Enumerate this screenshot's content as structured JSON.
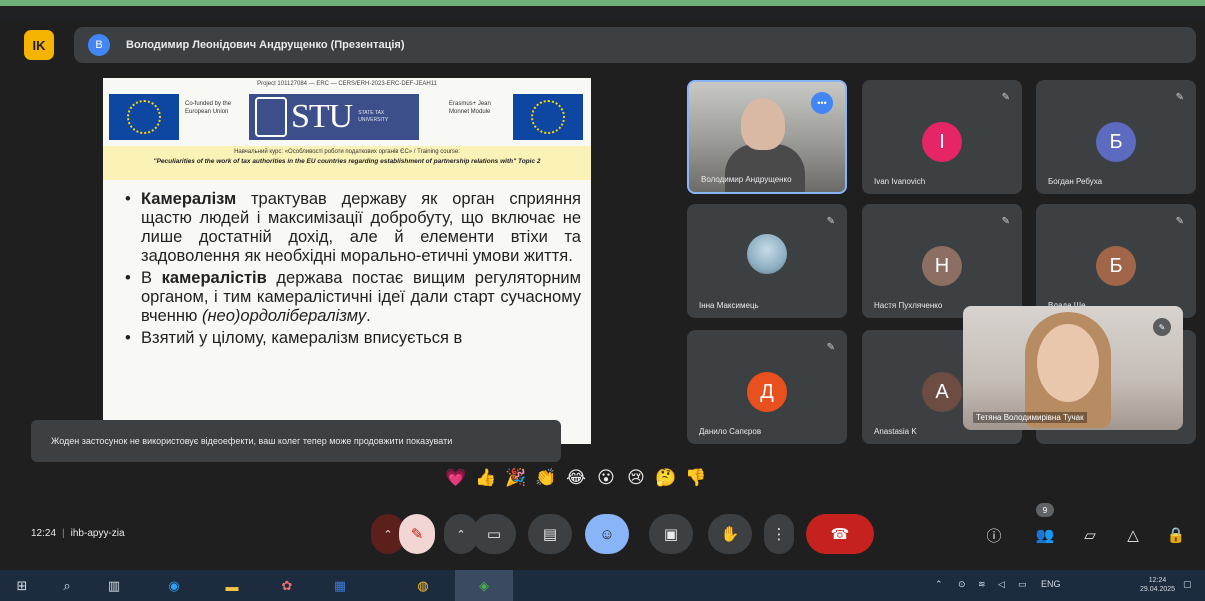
{
  "app": {
    "badge_label": "IK"
  },
  "presenter": {
    "avatar_letter": "В",
    "name": "Володимир Леонідович Андрущенко (Презентація)"
  },
  "slide": {
    "project_line": "Project 101127084 — ERC — CERS/ERH-2023-ERC-DEF-JEAH11",
    "eu_caption_left": "Co-funded by the European Union",
    "stu_letters": "STU",
    "stu_caption": "STATE TAX UNIVERSITY",
    "eu_caption_right": "Erasmus+ Jean Monnet Module",
    "course_line1": "Навчальний курс: «Особливості роботи податкових органів ЄС» / Training course:",
    "course_line2": "\"Peculiarities of the work of tax authorities in the EU countries regarding establishment of partnership relations with\" Topic 2",
    "bullet1_bold": "Камералізм",
    "bullet1_text": " трактував державу як орган сприяння щастю людей і максимізації добробуту, що включає не лише достатній дохід, але й елементи втіхи та задоволення як необхідні морально-етичні умови життя.",
    "bullet2_pre": "В ",
    "bullet2_bold": "камералістів",
    "bullet2_text": " держава постає вищим регуляторним органом, і тим камералістичні ідеї дали старт сучасному вченню ",
    "bullet2_italic": "(нео)ордолібералізму",
    "bullet2_end": ".",
    "bullet3_text": "Взятий у цілому, камералізм вписується в"
  },
  "notice": {
    "text": "Жоден застосунок не використовує відеоефекти, ваш колег тепер може продовжити показувати"
  },
  "tiles": [
    {
      "name": "Володимир Андрущенко",
      "avatar": "",
      "color": "",
      "type": "video"
    },
    {
      "name": "Ivan Ivanovich",
      "avatar": "І",
      "color": "#e52565",
      "type": "avatar"
    },
    {
      "name": "Богдан Ребуха",
      "avatar": "Б",
      "color": "#5c6bc0",
      "type": "avatar"
    },
    {
      "name": "Інна Максимець",
      "avatar": "",
      "color": "",
      "type": "photo"
    },
    {
      "name": "Настя Пухляченко",
      "avatar": "Н",
      "color": "#8d6e63",
      "type": "avatar"
    },
    {
      "name": "Влада Ше",
      "avatar": "Б",
      "color": "#a1664a",
      "type": "avatar"
    },
    {
      "name": "Данило Сапєров",
      "avatar": "Д",
      "color": "#e8501e",
      "type": "avatar"
    },
    {
      "name": "Anastasia K",
      "avatar": "А",
      "color": "#6d4c41",
      "type": "avatar"
    }
  ],
  "selfview": {
    "name": "Тетяна Володимирівна Тучак"
  },
  "reactions": [
    "💗",
    "👍",
    "🎉",
    "👏",
    "😂",
    "😮",
    "😢",
    "🤔",
    "👎"
  ],
  "meeting": {
    "time": "12:24",
    "code": "ihb-apyy-zia"
  },
  "icons": {
    "mic_off": "mic-off-icon",
    "camera": "camera-icon",
    "captions": "captions-icon",
    "emoji": "emoji-icon",
    "present": "present-icon",
    "hand": "raise-hand-icon",
    "more": "more-icon",
    "end_call": "end-call-icon",
    "info": "info-icon",
    "people": "people-icon",
    "chat": "chat-icon",
    "activities": "activities-icon",
    "lock": "host-controls-icon"
  },
  "participants_count": "9",
  "taskbar": {
    "lang": "ENG",
    "clock_time": "12:24",
    "clock_date": "29.04.2025"
  },
  "colors": {
    "end_call": "#c5221f",
    "accent": "#8ab4f8"
  }
}
